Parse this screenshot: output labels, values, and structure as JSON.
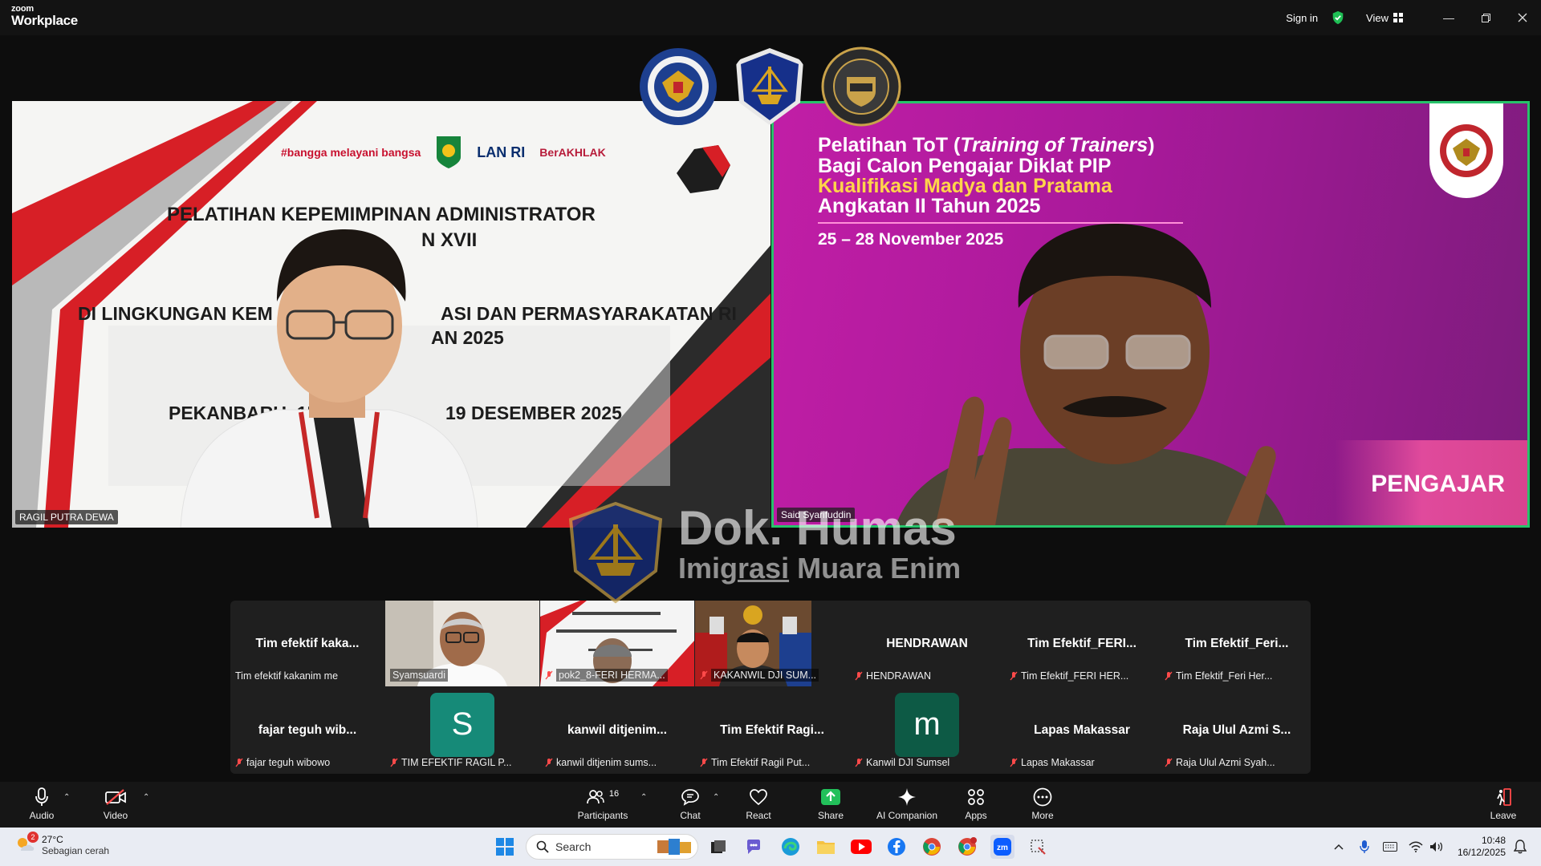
{
  "app": {
    "logo_top": "zoom",
    "logo_bottom": "Workplace"
  },
  "titlebar": {
    "sign_in": "Sign in",
    "view": "View"
  },
  "left_tile": {
    "name": "RAGIL PUTRA DEWA",
    "slide_logos": [
      "#bangga melayani bangsa",
      "LAN RI",
      "BerAKHLAK"
    ],
    "line1": "PELATIHAN KEPEMIMPINAN ADMINISTRATOR",
    "line2": "N XVII",
    "line3": "DI LINGKUNGAN KEM",
    "line3b": "ASI DAN PERMASYARAKATAN RI",
    "line4": "AN 2025",
    "line5": "PEKANBARU, 15",
    "line5b": "19 DESEMBER 2025"
  },
  "right_tile": {
    "name": "Said Syarifuddin",
    "l1a": "Pelatihan ToT (",
    "l1b": "Training of Trainers",
    "l1c": ")",
    "l2": "Bagi Calon Pengajar Diklat PIP",
    "l3": "Kualifikasi Madya dan Pratama",
    "l4": "Angkatan II Tahun 2025",
    "date": "25 – 28 November 2025",
    "badge": "PENGAJAR"
  },
  "watermark": {
    "line1": "Dok. Humas",
    "line2a": "Imig",
    "line2b": "rasi",
    "line2c": " Muara Enim"
  },
  "gallery": [
    {
      "big": "Tim efektif kaka...",
      "small": "Tim efektif kakanim me",
      "muted": false
    },
    {
      "small": "Syamsuardi",
      "muted": false
    },
    {
      "small": "pok2_8-FERI HERMA...",
      "muted": true
    },
    {
      "small": "KAKANWIL DJI SUM...",
      "muted": true
    },
    {
      "big": "HENDRAWAN",
      "small": "HENDRAWAN",
      "muted": true
    },
    {
      "big": "Tim Efektif_FERI...",
      "small": "Tim Efektif_FERI HER...",
      "muted": true
    },
    {
      "big": "Tim Efektif_Feri...",
      "small": "Tim Efektif_Feri Her...",
      "muted": true
    },
    {
      "big": "fajar teguh wib...",
      "small": "fajar teguh wibowo",
      "muted": true
    },
    {
      "avatar": "S",
      "small": "TIM EFEKTIF RAGIL P...",
      "muted": true
    },
    {
      "big": "kanwil ditjenim...",
      "small": "kanwil ditjenim sums...",
      "muted": true
    },
    {
      "big": "Tim Efektif Ragi...",
      "small": "Tim Efektif Ragil Put...",
      "muted": true
    },
    {
      "avatar": "m",
      "small": "Kanwil DJI Sumsel",
      "muted": true
    },
    {
      "big": "Lapas Makassar",
      "small": "Lapas Makassar",
      "muted": true
    },
    {
      "big": "Raja Ulul Azmi S...",
      "small": "Raja Ulul Azmi Syah...",
      "muted": true
    }
  ],
  "toolbar": {
    "audio": "Audio",
    "video": "Video",
    "participants": "Participants",
    "participants_count": "16",
    "chat": "Chat",
    "react": "React",
    "share": "Share",
    "ai": "AI Companion",
    "apps": "Apps",
    "more": "More",
    "leave": "Leave"
  },
  "taskbar": {
    "weather_temp": "27°C",
    "weather_desc": "Sebagian cerah",
    "weather_badge": "2",
    "search": "Search",
    "time": "10:48",
    "date": "16/12/2025"
  },
  "colors": {
    "accent_green": "#27c36a",
    "zoom_blue": "#0b5cff",
    "slide_magenta": "#c11ea6",
    "slide_red": "#d71f26"
  }
}
